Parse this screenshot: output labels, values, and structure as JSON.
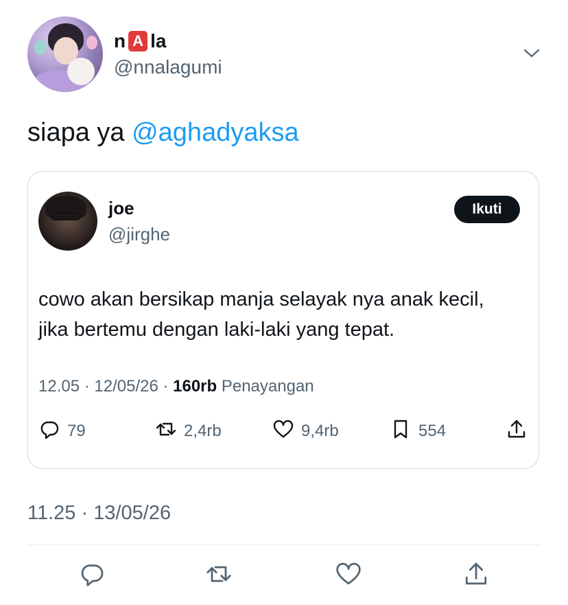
{
  "author": {
    "display_name_before": "n",
    "display_name_badge": "A",
    "display_name_after": "la",
    "handle": "@nnalagumi"
  },
  "tweet": {
    "text": "siapa ya ",
    "mention": "@aghadyaksa",
    "timestamp": "11.25 · 13/05/26"
  },
  "quoted": {
    "display_name": "joe",
    "handle": "@jirghe",
    "follow_label": "Ikuti",
    "body": "cowo akan bersikap manja selayak nya anak kecil, jika bertemu dengan laki-laki yang tepat.",
    "meta_time": "12.05 · 12/05/26 · ",
    "meta_views": "160rb",
    "meta_views_label": " Penayangan",
    "stats": {
      "replies": "79",
      "reposts": "2,4rb",
      "likes": "9,4rb",
      "bookmarks": "554"
    }
  },
  "icons": [
    "chevron-down-icon",
    "reply-icon",
    "repost-icon",
    "like-icon",
    "bookmark-icon",
    "share-icon"
  ],
  "colors": {
    "accent": "#1d9bf0",
    "text": "#0f1419",
    "muted": "#536471",
    "badge": "#e23a3a"
  }
}
